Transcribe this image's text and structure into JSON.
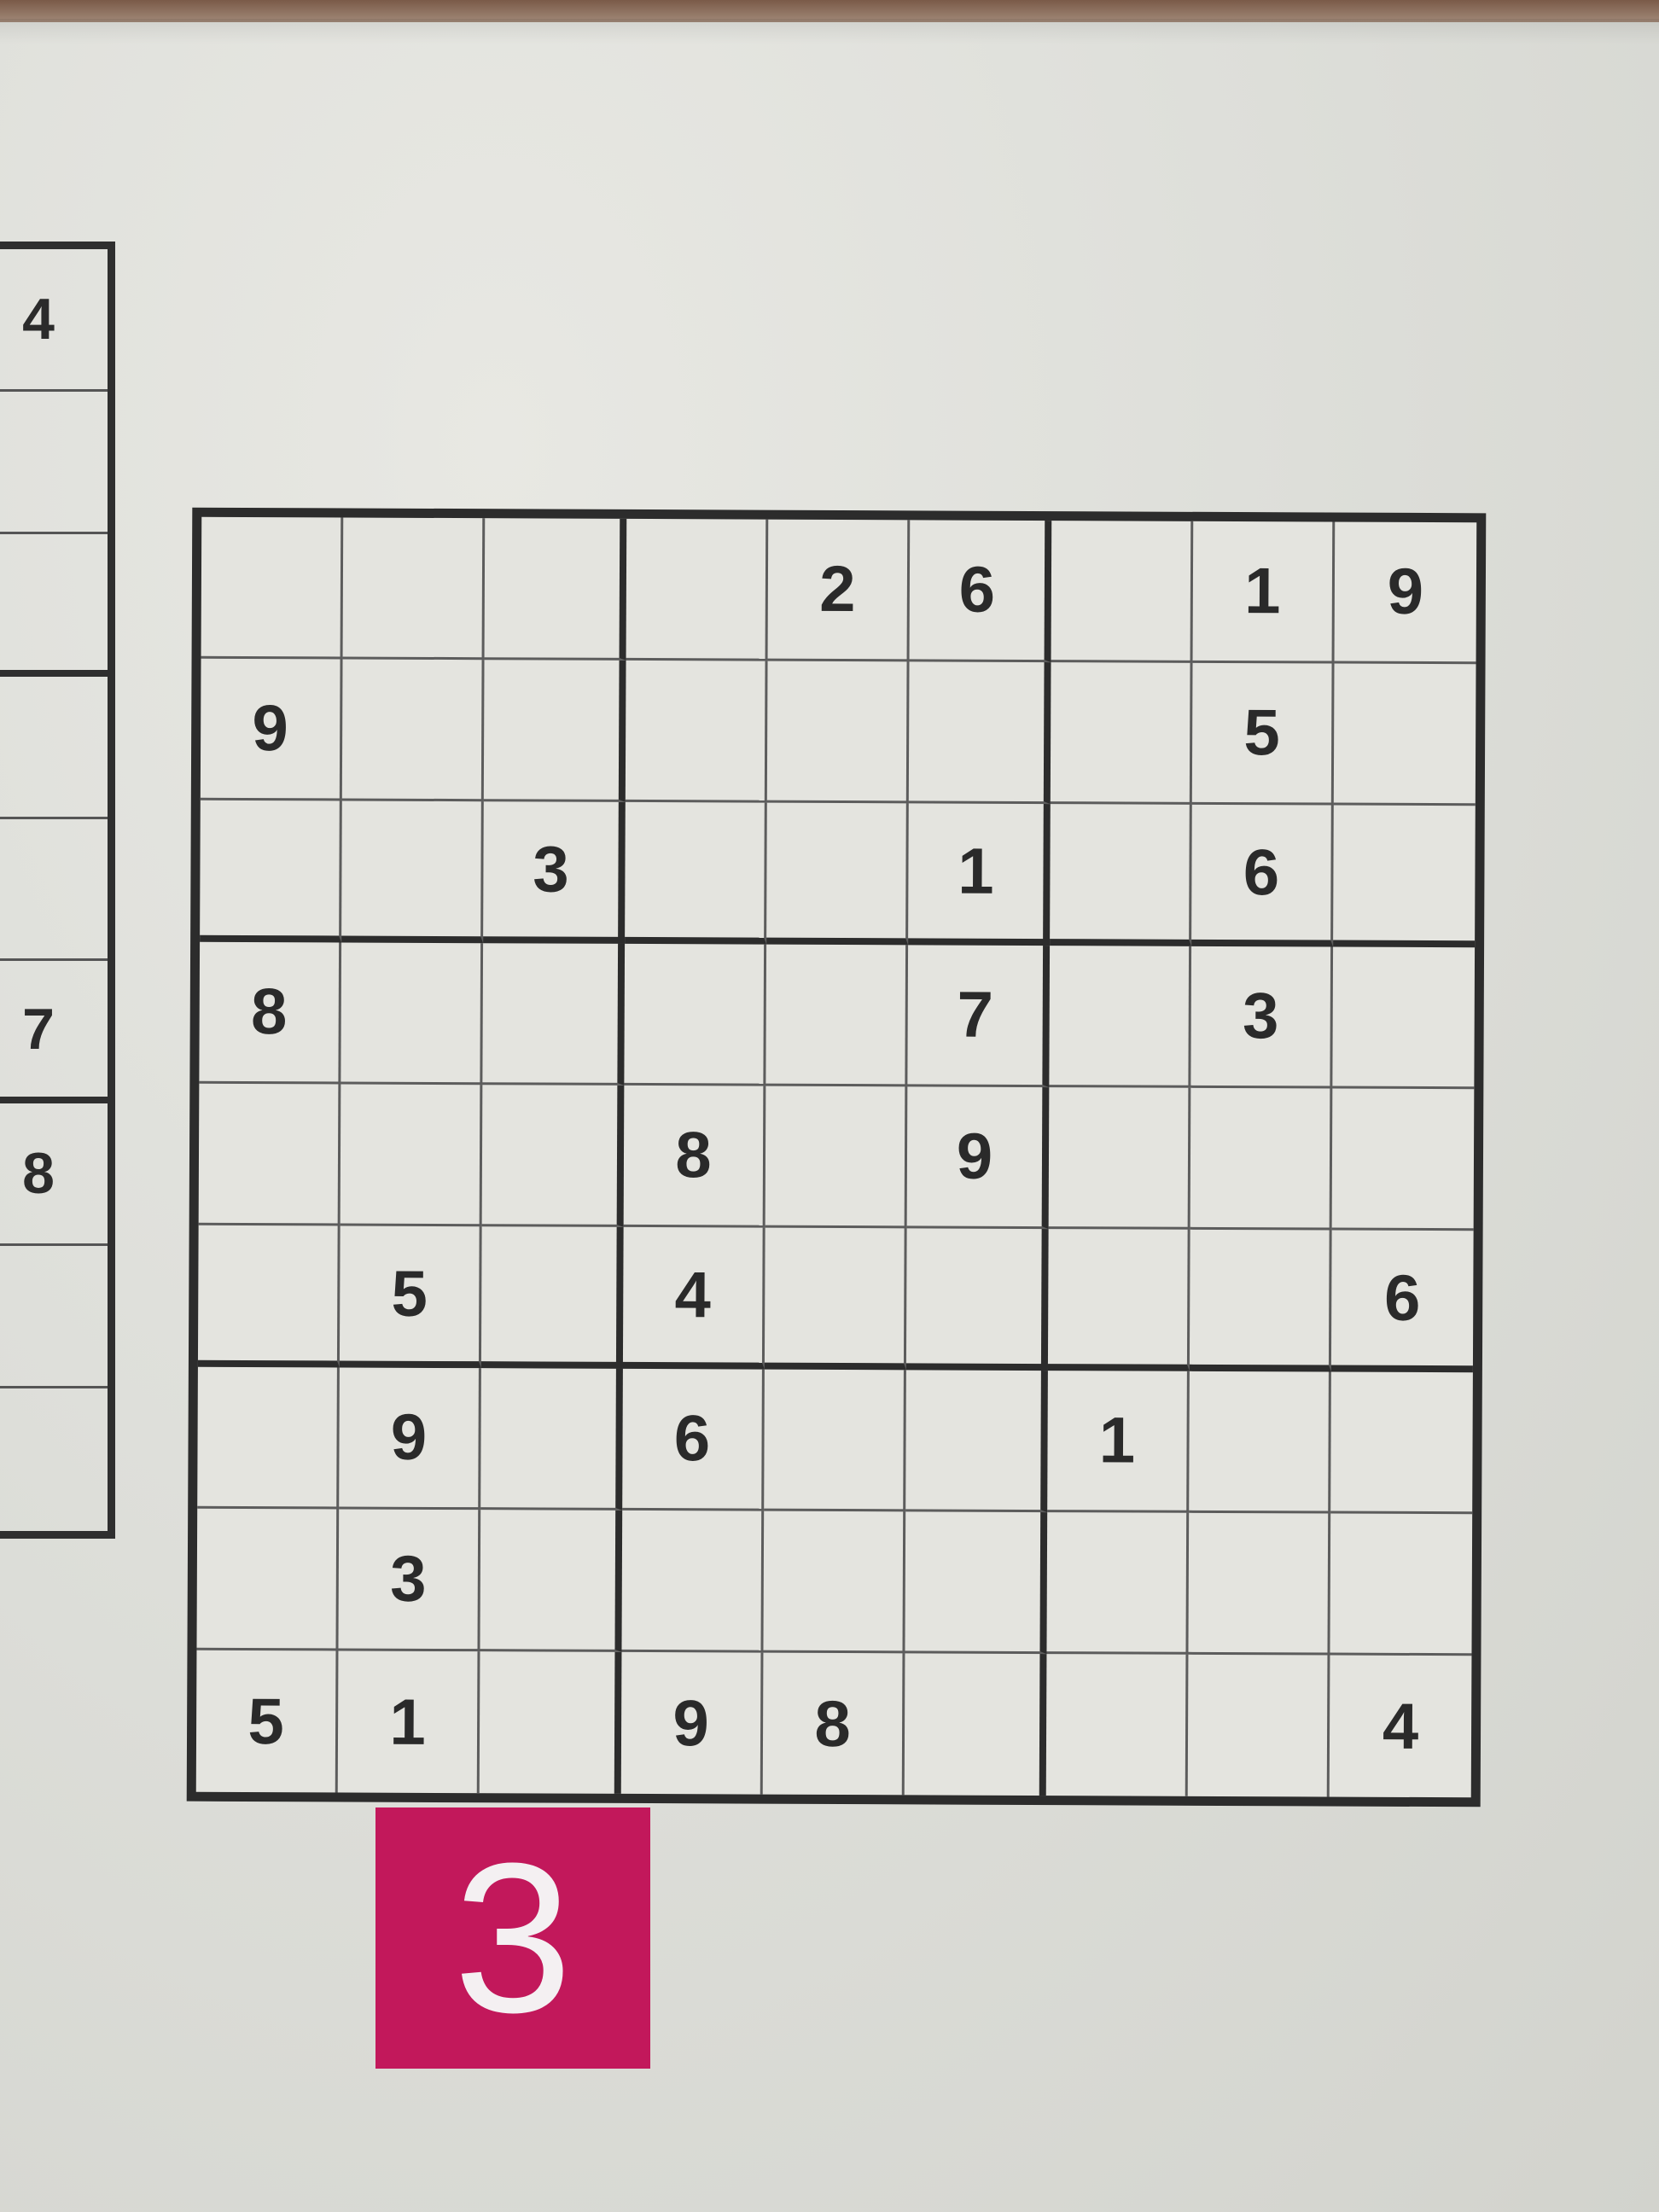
{
  "puzzle_number": "3",
  "colors": {
    "badge": "#c2185b",
    "ink": "#2a2a2a",
    "paper": "#e4e4df"
  },
  "left_puzzle": {
    "rows": [
      "",
      "4",
      "",
      "",
      "",
      "",
      "7",
      "8",
      "",
      ""
    ]
  },
  "grid": [
    [
      "",
      "",
      "",
      "",
      "2",
      "6",
      "",
      "1",
      "9"
    ],
    [
      "9",
      "",
      "",
      "",
      "",
      "",
      "",
      "5",
      ""
    ],
    [
      "",
      "",
      "3",
      "",
      "",
      "1",
      "",
      "6",
      ""
    ],
    [
      "8",
      "",
      "",
      "",
      "",
      "7",
      "",
      "3",
      ""
    ],
    [
      "",
      "",
      "",
      "8",
      "",
      "9",
      "",
      "",
      ""
    ],
    [
      "",
      "5",
      "",
      "4",
      "",
      "",
      "",
      "",
      "6"
    ],
    [
      "",
      "9",
      "",
      "6",
      "",
      "",
      "1",
      "",
      ""
    ],
    [
      "",
      "3",
      "",
      "",
      "",
      "",
      "",
      "",
      ""
    ],
    [
      "5",
      "1",
      "",
      "9",
      "8",
      "",
      "",
      "",
      "4"
    ]
  ]
}
